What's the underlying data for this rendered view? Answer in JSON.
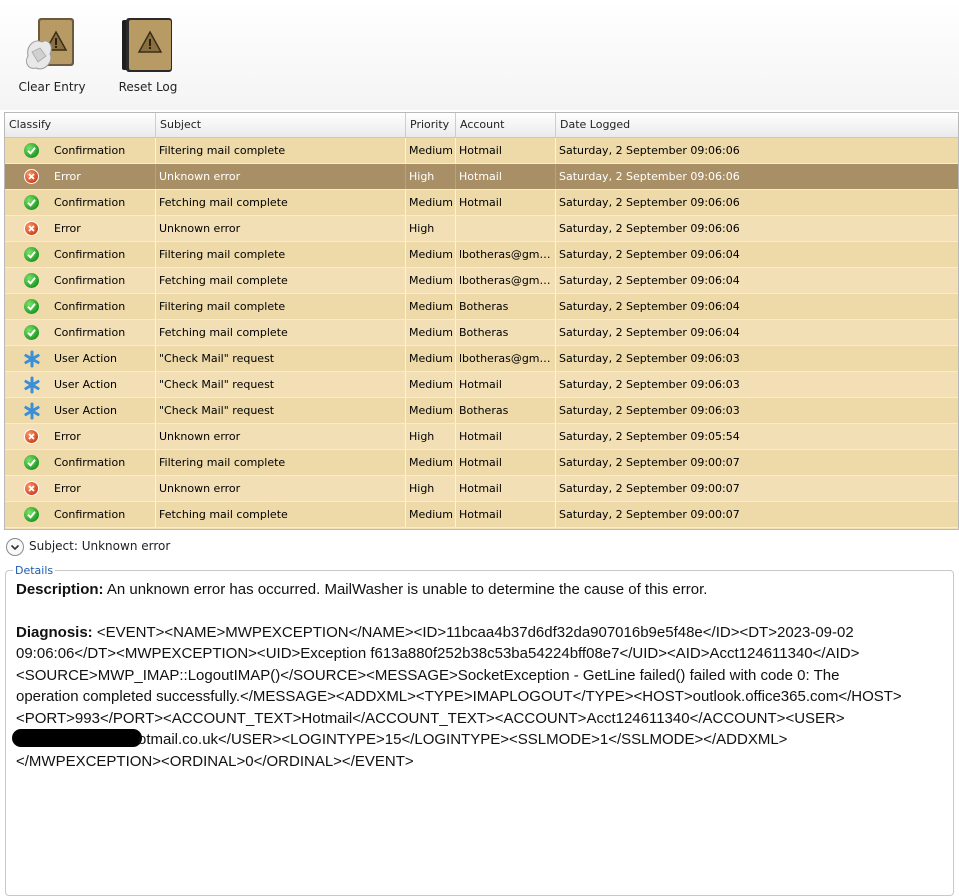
{
  "toolbar": {
    "clear_label": "Clear Entry",
    "reset_label": "Reset Log"
  },
  "columns": [
    "Classify",
    "Subject",
    "Priority",
    "Account",
    "Date Logged"
  ],
  "rows": [
    {
      "status": "ok",
      "classify": "Confirmation",
      "subject": "Filtering mail complete",
      "priority": "Medium",
      "account": "Hotmail",
      "date": "Saturday, 2 September 09:06:06"
    },
    {
      "status": "err",
      "classify": "Error",
      "subject": "Unknown error",
      "priority": "High",
      "account": "Hotmail",
      "date": "Saturday, 2 September 09:06:06",
      "selected": true
    },
    {
      "status": "ok",
      "classify": "Confirmation",
      "subject": "Fetching mail complete",
      "priority": "Medium",
      "account": "Hotmail",
      "date": "Saturday, 2 September 09:06:06"
    },
    {
      "status": "err",
      "classify": "Error",
      "subject": "Unknown error",
      "priority": "High",
      "account": "",
      "date": "Saturday, 2 September 09:06:06"
    },
    {
      "status": "ok",
      "classify": "Confirmation",
      "subject": "Filtering mail complete",
      "priority": "Medium",
      "account": "lbotheras@gmail....",
      "date": "Saturday, 2 September 09:06:04"
    },
    {
      "status": "ok",
      "classify": "Confirmation",
      "subject": "Fetching mail complete",
      "priority": "Medium",
      "account": "lbotheras@gmail....",
      "date": "Saturday, 2 September 09:06:04"
    },
    {
      "status": "ok",
      "classify": "Confirmation",
      "subject": "Filtering mail complete",
      "priority": "Medium",
      "account": "Botheras",
      "date": "Saturday, 2 September 09:06:04"
    },
    {
      "status": "ok",
      "classify": "Confirmation",
      "subject": "Fetching mail complete",
      "priority": "Medium",
      "account": "Botheras",
      "date": "Saturday, 2 September 09:06:04"
    },
    {
      "status": "act",
      "classify": "User Action",
      "subject": "\"Check Mail\" request",
      "priority": "Medium",
      "account": "lbotheras@gmail....",
      "date": "Saturday, 2 September 09:06:03"
    },
    {
      "status": "act",
      "classify": "User Action",
      "subject": "\"Check Mail\" request",
      "priority": "Medium",
      "account": "Hotmail",
      "date": "Saturday, 2 September 09:06:03"
    },
    {
      "status": "act",
      "classify": "User Action",
      "subject": "\"Check Mail\" request",
      "priority": "Medium",
      "account": "Botheras",
      "date": "Saturday, 2 September 09:06:03"
    },
    {
      "status": "err",
      "classify": "Error",
      "subject": "Unknown error",
      "priority": "High",
      "account": "Hotmail",
      "date": "Saturday, 2 September 09:05:54"
    },
    {
      "status": "ok",
      "classify": "Confirmation",
      "subject": "Filtering mail complete",
      "priority": "Medium",
      "account": "Hotmail",
      "date": "Saturday, 2 September 09:00:07"
    },
    {
      "status": "err",
      "classify": "Error",
      "subject": "Unknown error",
      "priority": "High",
      "account": "Hotmail",
      "date": "Saturday, 2 September 09:00:07"
    },
    {
      "status": "ok",
      "classify": "Confirmation",
      "subject": "Fetching mail complete",
      "priority": "Medium",
      "account": "Hotmail",
      "date": "Saturday, 2 September 09:00:07"
    }
  ],
  "subject_line": "Subject: Unknown error",
  "details": {
    "label": "Details",
    "description_label": "Description:",
    "description_text": " An unknown error has occurred. MailWasher is unable to determine the cause of this error.",
    "diagnosis_label": "Diagnosis:",
    "diagnosis_before": " <EVENT><NAME>MWPEXCEPTION</NAME><ID>11bcaa4b37d6df32da907016b9e5f48e</ID><DT>2023-09-02 09:06:06</DT><MWPEXCEPTION><UID>Exception f613a880f252b38c53ba54224bff08e7</UID><AID>Acct124611340</AID><SOURCE>MWP_IMAP::LogoutIMAP()</SOURCE><MESSAGE>SocketException - GetLine failed() failed with code 0: The operation completed successfully.</MESSAGE><ADDXML><TYPE>IMAPLOGOUT</TYPE><HOST>outlook.office365.com</HOST><PORT>993</PORT><ACCOUNT_TEXT>Hotmail</ACCOUNT_TEXT><ACCOUNT>Acct124611340</ACCOUNT><USER>",
    "diagnosis_after": "otmail.co.uk</USER><LOGINTYPE>15</LOGINTYPE><SSLMODE>1</SSLMODE></ADDXML></MWPEXCEPTION><ORDINAL>0</ORDINAL></EVENT>"
  }
}
